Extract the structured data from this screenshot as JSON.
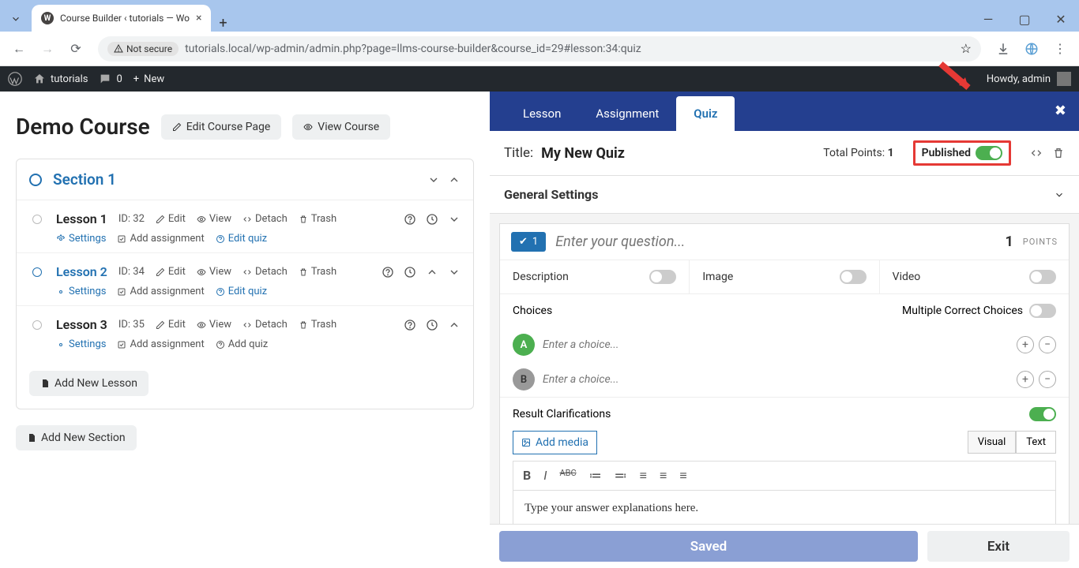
{
  "browser": {
    "tab_title": "Course Builder ‹ tutorials — Wo",
    "not_secure": "Not secure",
    "url": "tutorials.local/wp-admin/admin.php?page=llms-course-builder&course_id=29#lesson:34:quiz"
  },
  "wpbar": {
    "site": "tutorials",
    "comments": "0",
    "new": "New",
    "howdy": "Howdy, admin"
  },
  "course": {
    "title": "Demo Course",
    "edit_page": "Edit Course Page",
    "view": "View Course"
  },
  "section": {
    "title": "Section 1"
  },
  "lessons": [
    {
      "title": "Lesson 1",
      "id": "ID: 32",
      "edit": "Edit",
      "view": "View",
      "detach": "Detach",
      "trash": "Trash",
      "settings": "Settings",
      "add_assign": "Add assignment",
      "quiz": "Edit quiz",
      "active": false
    },
    {
      "title": "Lesson 2",
      "id": "ID: 34",
      "edit": "Edit",
      "view": "View",
      "detach": "Detach",
      "trash": "Trash",
      "settings": "Settings",
      "add_assign": "Add assignment",
      "quiz": "Edit quiz",
      "active": true
    },
    {
      "title": "Lesson 3",
      "id": "ID: 35",
      "edit": "Edit",
      "view": "View",
      "detach": "Detach",
      "trash": "Trash",
      "settings": "Settings",
      "add_assign": "Add assignment",
      "quiz": "Add quiz",
      "active": false
    }
  ],
  "add_lesson": "Add New Lesson",
  "add_section": "Add New Section",
  "tabs": {
    "lesson": "Lesson",
    "assignment": "Assignment",
    "quiz": "Quiz"
  },
  "quiz": {
    "title_label": "Title:",
    "title": "My New Quiz",
    "total_points_label": "Total Points:",
    "total_points": "1",
    "published": "Published"
  },
  "general_settings": "General Settings",
  "question": {
    "badge": "1",
    "placeholder": "Enter your question...",
    "points": "1",
    "points_label": "POINTS",
    "description": "Description",
    "image": "Image",
    "video": "Video",
    "choices": "Choices",
    "multiple": "Multiple Correct Choices",
    "choice_placeholder": "Enter a choice...",
    "ch_a": "A",
    "ch_b": "B",
    "result": "Result Clarifications",
    "add_media": "Add media",
    "visual": "Visual",
    "text": "Text",
    "editor_body": "Type your answer explanations here."
  },
  "footer": {
    "saved": "Saved",
    "exit": "Exit"
  }
}
